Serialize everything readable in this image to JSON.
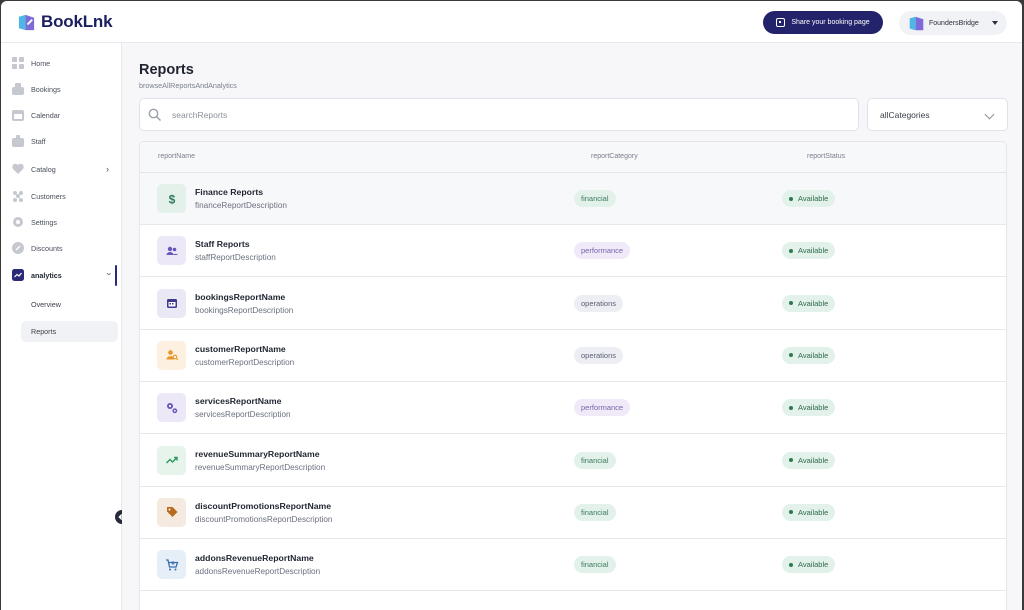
{
  "app": {
    "name": "BookLnk"
  },
  "header": {
    "share_label": "Share your booking page",
    "account_name": "FoundersBridge"
  },
  "sidebar": {
    "items": [
      {
        "label": "Home",
        "icon": "home-icon"
      },
      {
        "label": "Bookings",
        "icon": "bookings-icon"
      },
      {
        "label": "Calendar",
        "icon": "calendar-icon"
      },
      {
        "label": "Staff",
        "icon": "staff-icon"
      },
      {
        "label": "Catalog",
        "icon": "heart-icon"
      },
      {
        "label": "Customers",
        "icon": "customers-icon"
      },
      {
        "label": "Settings",
        "icon": "gear-icon"
      },
      {
        "label": "Discounts",
        "icon": "discount-icon"
      },
      {
        "label": "analytics",
        "icon": "analytics-icon"
      }
    ],
    "sub_items": [
      {
        "label": "Overview"
      },
      {
        "label": "Reports"
      }
    ]
  },
  "page": {
    "title": "Reports",
    "subtitle": "browseAllReportsAndAnalytics",
    "search_placeholder": "searchReports",
    "category_value": "allCategories"
  },
  "table": {
    "headers": {
      "name": "reportName",
      "category": "reportCategory",
      "status": "reportStatus"
    },
    "rows": [
      {
        "name": "Finance Reports",
        "desc": "financeReportDescription",
        "category": "financial",
        "status": "Available",
        "icon": "dollar-icon",
        "accent": "#2f7d5b",
        "tint": "#e3f1ea"
      },
      {
        "name": "Staff Reports",
        "desc": "staffReportDescription",
        "category": "performance",
        "status": "Available",
        "icon": "people-icon",
        "accent": "#6b55b8",
        "tint": "#ece8f7"
      },
      {
        "name": "bookingsReportName",
        "desc": "bookingsReportDescription",
        "category": "operations",
        "status": "Available",
        "icon": "calendar-icon",
        "accent": "#3f3a8f",
        "tint": "#e9e8f4"
      },
      {
        "name": "customerReportName",
        "desc": "customerReportDescription",
        "category": "operations",
        "status": "Available",
        "icon": "customer-search-icon",
        "accent": "#e8962b",
        "tint": "#fdf0e0"
      },
      {
        "name": "servicesReportName",
        "desc": "servicesReportDescription",
        "category": "performance",
        "status": "Available",
        "icon": "gears-icon",
        "accent": "#6b55b8",
        "tint": "#ece8f7"
      },
      {
        "name": "revenueSummaryReportName",
        "desc": "revenueSummaryReportDescription",
        "category": "financial",
        "status": "Available",
        "icon": "trend-icon",
        "accent": "#2f9a63",
        "tint": "#e6f4ec"
      },
      {
        "name": "discountPromotionsReportName",
        "desc": "discountPromotionsReportDescription",
        "category": "financial",
        "status": "Available",
        "icon": "tag-icon",
        "accent": "#b86a1f",
        "tint": "#f5eadf"
      },
      {
        "name": "addonsRevenueReportName",
        "desc": "addonsRevenueReportDescription",
        "category": "financial",
        "status": "Available",
        "icon": "cart-icon",
        "accent": "#3a6fb0",
        "tint": "#e6eef7"
      }
    ]
  },
  "colors": {
    "brand": "#23236b",
    "available": "#2d7a50"
  }
}
